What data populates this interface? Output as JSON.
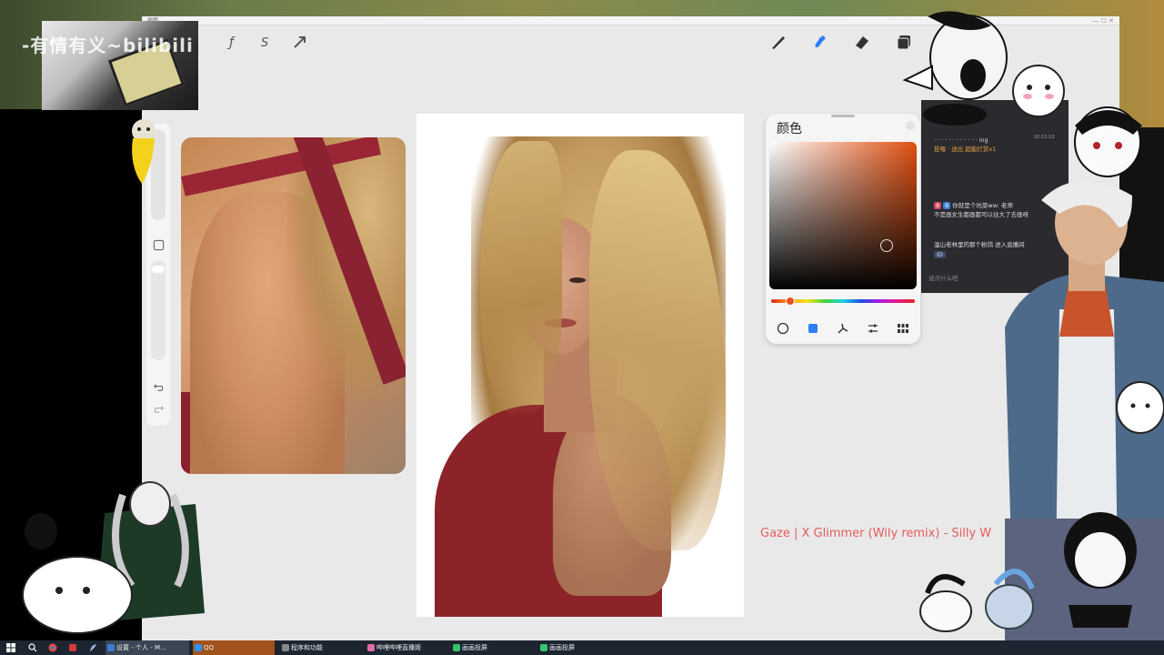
{
  "app": {
    "title": "画图",
    "window_controls": "— ☐ ✕"
  },
  "toolbar": {
    "left_tools": [
      {
        "icon": "adjust-icon",
        "glyph": "ƒ"
      },
      {
        "icon": "selection-icon",
        "glyph": "S"
      },
      {
        "icon": "transform-icon",
        "glyph": "➚"
      }
    ],
    "right_tools": [
      {
        "icon": "brush-icon",
        "active": false
      },
      {
        "icon": "smudge-icon",
        "active": true
      },
      {
        "icon": "eraser-icon",
        "active": false
      },
      {
        "icon": "layers-icon",
        "active": false
      }
    ],
    "accent": "#2f7ef5"
  },
  "color_panel": {
    "title": "颜色",
    "base_hue": "#e04e10",
    "modes": [
      "disc-icon",
      "classic-icon",
      "harmony-icon",
      "value-icon",
      "palettes-icon"
    ],
    "active_mode": 1
  },
  "overlay": {
    "watermark": "-有情有义~bilibili"
  },
  "chat": {
    "time": "02:11:13",
    "messages": [
      {
        "badge": "",
        "text": "· · · · · · · · · · · · ing"
      },
      {
        "badge": "",
        "text": "投喂 · 送出 超能打赏x1"
      },
      {
        "badge": "8",
        "badge2": "6",
        "text": "你就是个坑菜ww: 老师"
      },
      {
        "badge": "",
        "text": "不是画女生都画都可以往大了去画呀"
      },
      {
        "badge": "",
        "text": "湿山老林里的那个粉鸽 进入直播间"
      }
    ],
    "chat_chip": "ID",
    "input_placeholder": "说点什么吧"
  },
  "song": {
    "text": "Gaze | X Glimmer (Wily remix) - Silly W"
  },
  "taskbar": {
    "items": [
      {
        "label": "设置 - 个人 - M...",
        "color": "#3b7bd6",
        "state": "active"
      },
      {
        "label": "QQ",
        "color": "#2a93ff",
        "state": "orange"
      },
      {
        "label": "程序和功能",
        "color": "#888888",
        "state": "normal"
      },
      {
        "label": "哔哩哔哩直播姬",
        "color": "#e36ca9",
        "state": "normal"
      },
      {
        "label": "画画投屏",
        "color": "#34c36a",
        "state": "normal"
      },
      {
        "label": "画画投屏",
        "color": "#34c36a",
        "state": "normal"
      }
    ]
  }
}
